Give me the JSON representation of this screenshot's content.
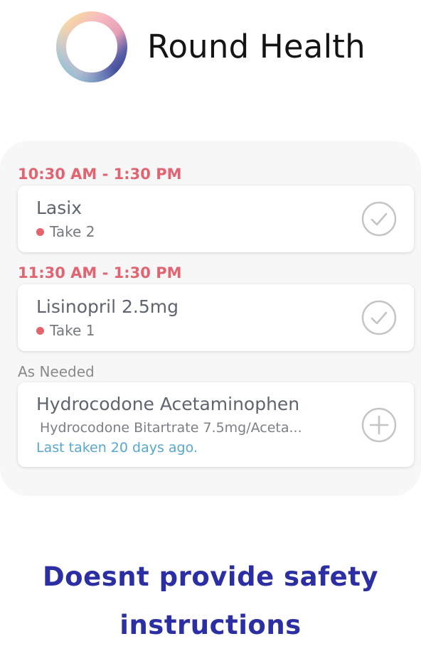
{
  "app": {
    "title": "Round Health",
    "logo_icon": "ring-logo-icon"
  },
  "schedule": [
    {
      "time_label": "10:30 AM - 1:30 PM",
      "medication": "Lasix",
      "dose": "Take 2",
      "action_icon": "check-circle-icon"
    },
    {
      "time_label": "11:30 AM - 1:30 PM",
      "medication": "Lisinopril 2.5mg",
      "dose": "Take 1",
      "action_icon": "check-circle-icon"
    }
  ],
  "as_needed": {
    "label": "As Needed",
    "medication": "Hydrocodone Acetaminophen",
    "detail": "Hydrocodone Bitartrate 7.5mg/Aceta...",
    "last_taken": "Last taken 20 days ago.",
    "action_icon": "plus-circle-icon"
  },
  "caption": {
    "line1": "Doesnt provide safety",
    "line2": "instructions"
  },
  "colors": {
    "time_label": "#e16470",
    "dose_dot": "#e6626f",
    "last_taken": "#57a7cf",
    "caption": "#2c2fa3",
    "panel_bg": "#f7f7f8"
  }
}
